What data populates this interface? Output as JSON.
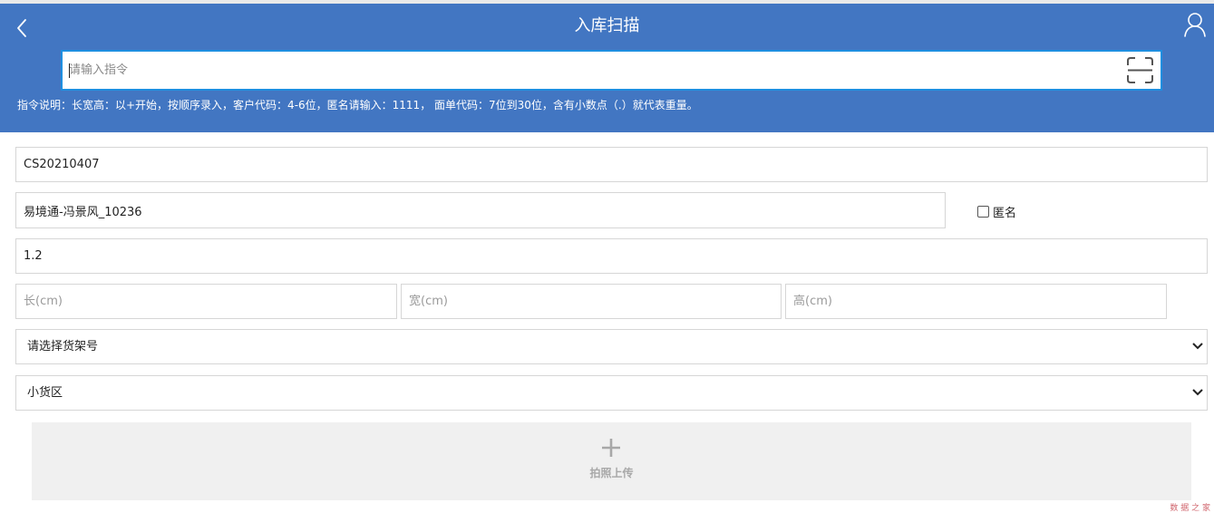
{
  "header": {
    "title": "入库扫描",
    "back_icon": "chevron-left-icon",
    "user_icon": "user-icon",
    "background_color": "#4276c2"
  },
  "command": {
    "placeholder": "请输入指令",
    "value": "",
    "scan_icon": "scan-icon",
    "border_color": "#1f8fe0"
  },
  "instructions": "指令说明：长宽高：以+开始，按顺序录入，客户代码：4-6位，匿名请输入：1111， 面单代码：7位到30位，含有小数点（.）就代表重量。",
  "form": {
    "order_code": "CS20210407",
    "customer": "易境通-冯景风_10236",
    "anonymous_label": "匿名",
    "anonymous_checked": false,
    "weight": "1.2",
    "length_placeholder": "长(cm)",
    "width_placeholder": "宽(cm)",
    "height_placeholder": "高(cm)",
    "shelf_select": "请选择货架号",
    "area_select": "小货区"
  },
  "upload": {
    "label": "拍照上传",
    "icon": "plus-icon"
  },
  "watermark": "数 据 之 家"
}
